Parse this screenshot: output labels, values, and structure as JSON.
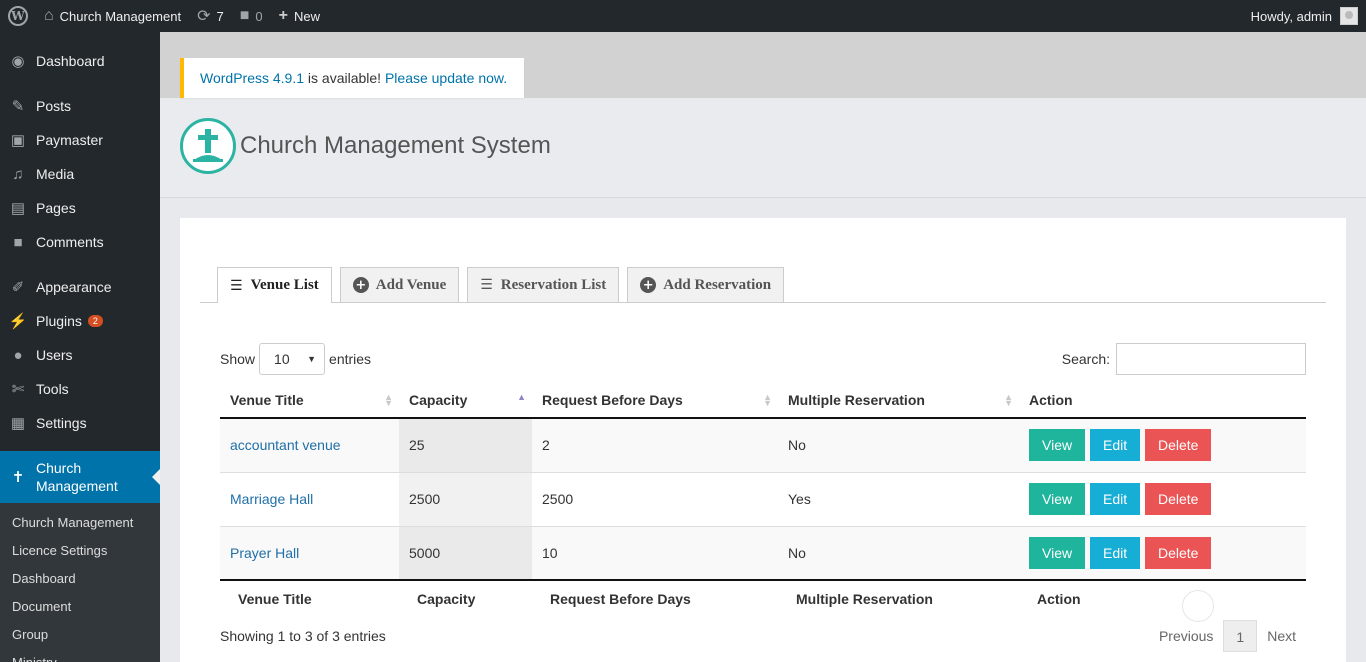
{
  "adminbar": {
    "site_name": "Church Management",
    "updates_count": "7",
    "comments_count": "0",
    "new_label": "New",
    "howdy": "Howdy, admin"
  },
  "sidebar": {
    "items": [
      {
        "label": "Dashboard",
        "icon": "dashboard-icon"
      },
      {
        "label": "Posts",
        "icon": "pin-icon"
      },
      {
        "label": "Paymaster",
        "icon": "image-icon"
      },
      {
        "label": "Media",
        "icon": "media-icon"
      },
      {
        "label": "Pages",
        "icon": "pages-icon"
      },
      {
        "label": "Comments",
        "icon": "comment-icon"
      },
      {
        "label": "Appearance",
        "icon": "brush-icon"
      },
      {
        "label": "Plugins",
        "icon": "plug-icon",
        "badge": "2"
      },
      {
        "label": "Users",
        "icon": "user-icon"
      },
      {
        "label": "Tools",
        "icon": "wrench-icon"
      },
      {
        "label": "Settings",
        "icon": "settings-icon"
      }
    ],
    "current": {
      "label_line1": "Church",
      "label_line2": "Management",
      "icon": "cross-icon"
    },
    "submenu": [
      "Church Management",
      "Licence Settings",
      "Dashboard",
      "Document",
      "Group",
      "Ministry"
    ]
  },
  "notice": {
    "version_link": "WordPress 4.9.1",
    "middle_text": " is available! ",
    "update_link": "Please update now."
  },
  "brand": {
    "title": "Church Management System"
  },
  "tabs": [
    {
      "label": "Venue List",
      "icon": "list-icon",
      "active": true
    },
    {
      "label": "Add Venue",
      "icon": "plus-circle-icon",
      "active": false
    },
    {
      "label": "Reservation List",
      "icon": "list-icon",
      "active": false
    },
    {
      "label": "Add Reservation",
      "icon": "plus-circle-icon",
      "active": false
    }
  ],
  "datatable": {
    "show_label": "Show",
    "page_length": "10",
    "entries_label": "entries",
    "search_label": "Search:",
    "search_value": "",
    "columns": [
      "Venue Title",
      "Capacity",
      "Request Before Days",
      "Multiple Reservation",
      "Action"
    ],
    "rows": [
      {
        "title": "accountant venue",
        "capacity": "25",
        "request_before_days": "2",
        "multiple": "No"
      },
      {
        "title": "Marriage Hall",
        "capacity": "2500",
        "request_before_days": "2500",
        "multiple": "Yes"
      },
      {
        "title": "Prayer Hall",
        "capacity": "5000",
        "request_before_days": "10",
        "multiple": "No"
      }
    ],
    "actions": {
      "view": "View",
      "edit": "Edit",
      "delete": "Delete"
    },
    "info": "Showing 1 to 3 of 3 entries",
    "pager": {
      "previous": "Previous",
      "current": "1",
      "next": "Next"
    }
  },
  "colors": {
    "accent": "#0073aa",
    "view": "#1fb49c",
    "edit": "#17aed6",
    "delete": "#ea5455",
    "logo": "#2bb3a3"
  }
}
